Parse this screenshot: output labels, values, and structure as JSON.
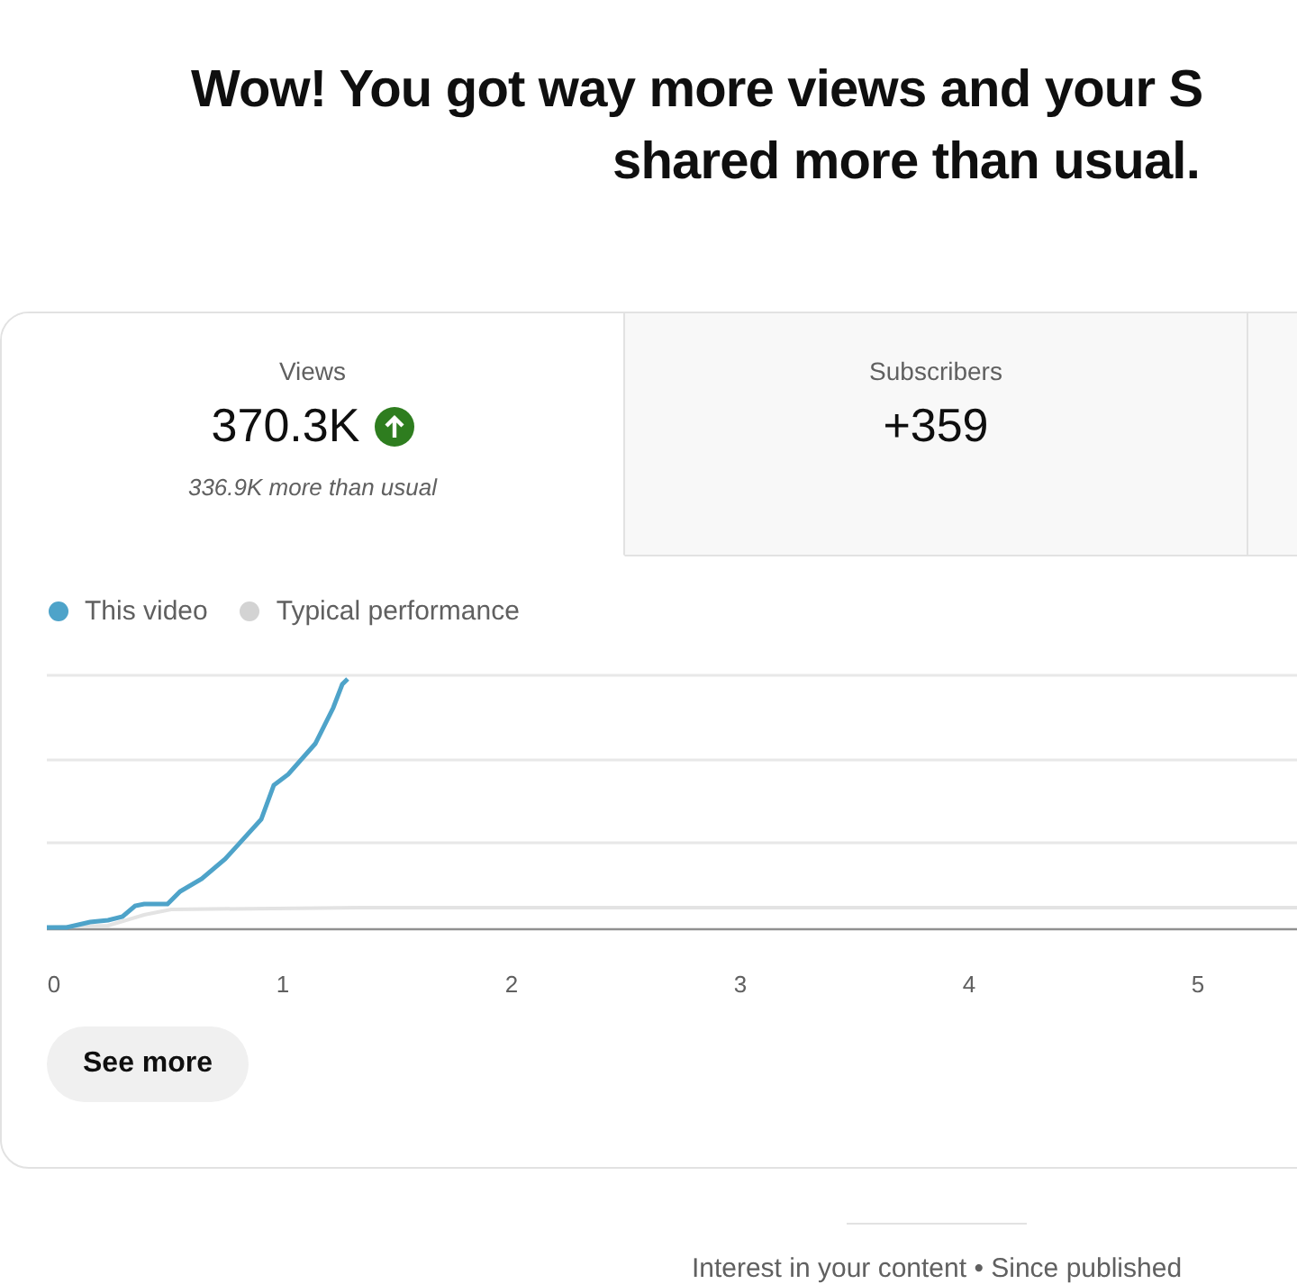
{
  "headline": [
    "Wow! You got way more views and your S",
    "shared more than usual."
  ],
  "metric_tabs": [
    {
      "label": "Views",
      "value": "370.3K",
      "trending_up": true,
      "note": "336.9K more than usual",
      "selected": true
    },
    {
      "label": "Subscribers",
      "value": "+359",
      "selected": false
    }
  ],
  "legend": [
    {
      "label": "This video",
      "color": "#4ea3c9"
    },
    {
      "label": "Typical performance",
      "color": "#d3d3d3"
    }
  ],
  "x_axis_labels": [
    "0",
    "1",
    "2",
    "3",
    "4",
    "5"
  ],
  "see_more_button": "See more",
  "footer_caption": "Interest in your content • Since published"
}
